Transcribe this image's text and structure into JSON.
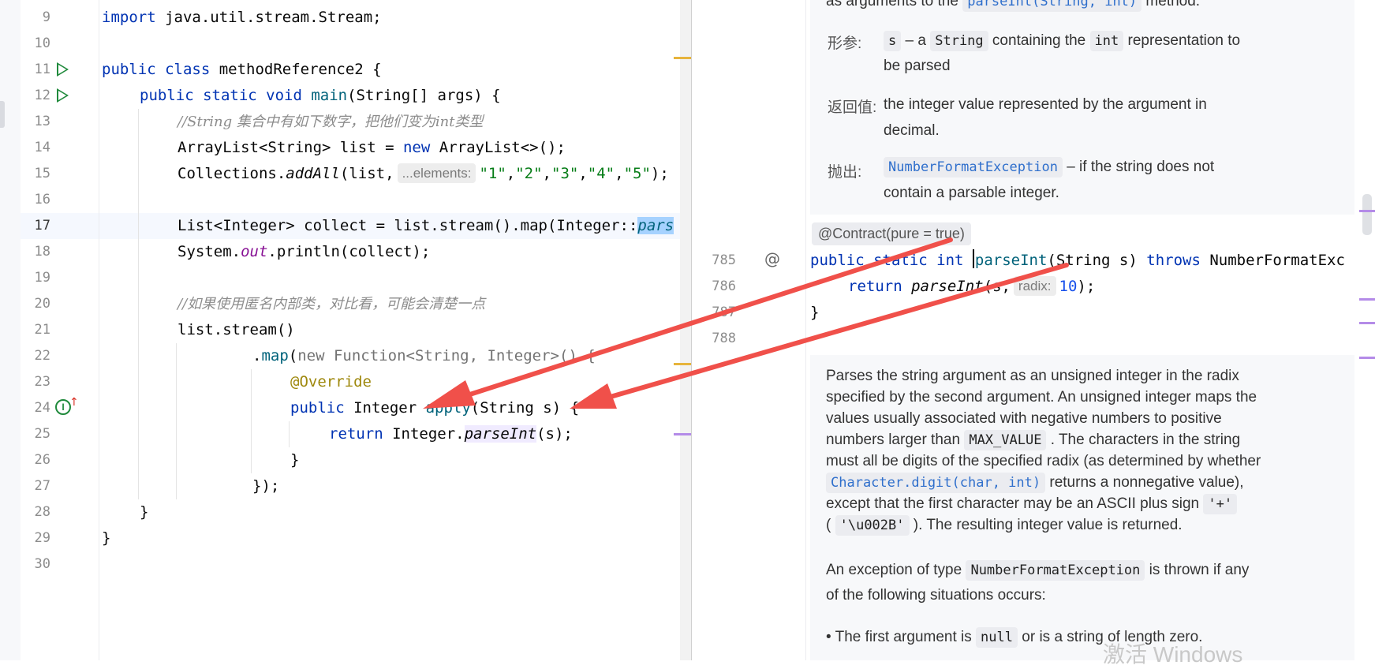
{
  "editor": {
    "lines": [
      {
        "n": "9"
      },
      {
        "n": "10"
      },
      {
        "n": "11"
      },
      {
        "n": "12"
      },
      {
        "n": "13"
      },
      {
        "n": "14"
      },
      {
        "n": "15"
      },
      {
        "n": "16"
      },
      {
        "n": "17"
      },
      {
        "n": "18"
      },
      {
        "n": "19"
      },
      {
        "n": "20"
      },
      {
        "n": "21"
      },
      {
        "n": "22"
      },
      {
        "n": "23"
      },
      {
        "n": "24"
      },
      {
        "n": "25"
      },
      {
        "n": "26"
      },
      {
        "n": "27"
      },
      {
        "n": "28"
      },
      {
        "n": "29"
      },
      {
        "n": "30"
      }
    ],
    "t": {
      "l9_import": "import",
      "l9_rest": " java.util.stream.Stream;",
      "l11_public": "public",
      "l11_class": " class ",
      "l11_name": "methodReference2 {",
      "l12_mods": "public static void ",
      "l12_main": "main",
      "l12_rest": "(String[] args) {",
      "l13_comment": "//String 集合中有如下数字，把他们变为int类型",
      "l14_a": "ArrayList<String> list = ",
      "l14_new": "new",
      "l14_b": " ArrayList<>();",
      "l15_a": "Collections.",
      "l15_add": "addAll",
      "l15_b": "(list,",
      "l15_hint": "...elements:",
      "l15_s1": "\"1\"",
      "l15_s2": "\"2\"",
      "l15_s3": "\"3\"",
      "l15_s4": "\"4\"",
      "l15_s5": "\"5\"",
      "l15_end": ");",
      "l17_a": "List<Integer> collect = list.stream().map(Integer::",
      "l17_sel": "pars",
      "l18_a": "System.",
      "l18_out": "out",
      "l18_b": ".println(collect);",
      "l20_comment": "//如果使用匿名内部类，对比看，可能会清楚一点",
      "l21": "list.stream()",
      "l22_a": ".",
      "l22_map": "map",
      "l22_b": "(",
      "l22_new": "new Function<String, Integer>() {",
      "l23": "@Override",
      "l24_pub": "public",
      "l24_a": " Integer ",
      "l24_apply": "apply",
      "l24_b": "(String s) {",
      "l25_ret": "return",
      "l25_a": " Integer.",
      "l25_parse": "parseInt",
      "l25_b": "(s);",
      "l26": "}",
      "l27": "});",
      "l28": "}",
      "l29": "}"
    }
  },
  "doc": {
    "top_partial_a": "as arguments to the ",
    "top_partial_link": "parseInt(String, int)",
    "top_partial_b": " method.",
    "params_label": "形参:",
    "params_chip_s": "s",
    "params_a": " – a ",
    "params_chip_string": "String",
    "params_b": " containing the ",
    "params_chip_int": "int",
    "params_c": " representation to",
    "params_d": "be parsed",
    "returns_label": "返回值:",
    "returns_a": "the integer value represented by the argument in",
    "returns_b": "decimal.",
    "throws_label": "抛出:",
    "throws_chip": "NumberFormatException",
    "throws_a": " – if the string does not",
    "throws_b": "contain a parsable integer.",
    "contract": "@Contract(pure = true)",
    "code_lines": [
      {
        "n": "785"
      },
      {
        "n": "786"
      },
      {
        "n": "787"
      },
      {
        "n": "788"
      }
    ],
    "c785_mods": "public static int ",
    "c785_name": "parseInt",
    "c785_a": "(String s) ",
    "c785_throws": "throws",
    "c785_b": " NumberFormatExc",
    "c786_ret": "return",
    "c786_call": " parseInt",
    "c786_a": "(s,",
    "c786_hint": "radix:",
    "c786_num": "10",
    "c786_b": ");",
    "c787": "}",
    "p1_1": "Parses the string argument as an unsigned integer in the radix",
    "p1_2": "specified by the second argument. An unsigned integer maps the",
    "p1_3": "values usually associated with negative numbers to positive",
    "p1_4a": "numbers larger than ",
    "p1_4chip": "MAX_VALUE",
    "p1_4b": " . The characters in the string",
    "p1_5": "must all be digits of the specified radix (as determined by whether",
    "p1_6chip": "Character.digit(char, int)",
    "p1_6b": " returns a nonnegative value),",
    "p1_7a": "except that the first character may be an ASCII plus sign ",
    "p1_7chip": "'+'",
    "p1_8a": "( ",
    "p1_8chip": "'\\u002B'",
    "p1_8b": " ). The resulting integer value is returned.",
    "p2_1a": "An exception of type ",
    "p2_1chip": "NumberFormatException",
    "p2_1b": " is thrown if any",
    "p2_2": "of the following situations occurs:",
    "p3_a": "• The first argument is ",
    "p3_chip": "null",
    "p3_b": " or is a string of length zero."
  },
  "watermark": "激活 Windows",
  "colors": {
    "arrow": "#f0504a",
    "run_icon": "#208a3c"
  }
}
